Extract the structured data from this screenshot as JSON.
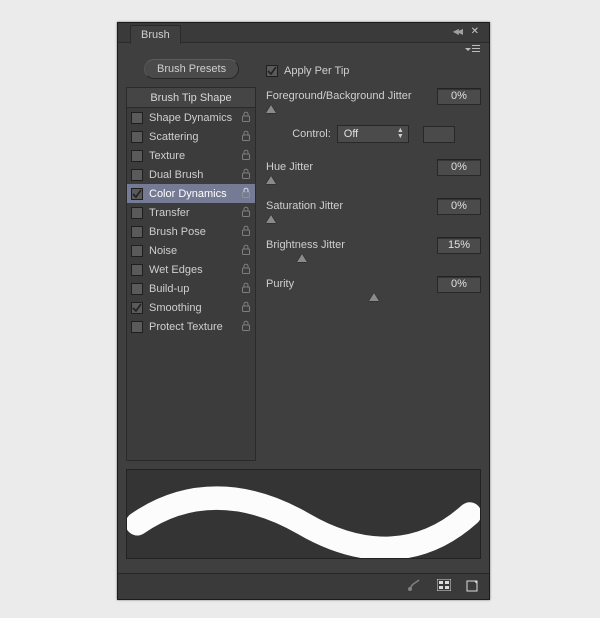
{
  "tab_title": "Brush",
  "brush_presets_label": "Brush Presets",
  "brush_tip_shape_label": "Brush Tip Shape",
  "categories": [
    {
      "label": "Shape Dynamics",
      "checked": false,
      "locked": true
    },
    {
      "label": "Scattering",
      "checked": false,
      "locked": true
    },
    {
      "label": "Texture",
      "checked": false,
      "locked": true
    },
    {
      "label": "Dual Brush",
      "checked": false,
      "locked": true
    },
    {
      "label": "Color Dynamics",
      "checked": true,
      "locked": true,
      "selected": true
    },
    {
      "label": "Transfer",
      "checked": false,
      "locked": true
    },
    {
      "label": "Brush Pose",
      "checked": false,
      "locked": true
    },
    {
      "label": "Noise",
      "checked": false,
      "locked": true
    },
    {
      "label": "Wet Edges",
      "checked": false,
      "locked": true
    },
    {
      "label": "Build-up",
      "checked": false,
      "locked": true
    },
    {
      "label": "Smoothing",
      "checked": true,
      "locked": true
    },
    {
      "label": "Protect Texture",
      "checked": false,
      "locked": true
    }
  ],
  "apply_per_tip": {
    "label": "Apply Per Tip",
    "checked": true
  },
  "fg_bg_jitter": {
    "label": "Foreground/Background Jitter",
    "value": "0%",
    "slider": 0
  },
  "control": {
    "label": "Control:",
    "value": "Off"
  },
  "hue_jitter": {
    "label": "Hue Jitter",
    "value": "0%",
    "slider": 0
  },
  "saturation_jitter": {
    "label": "Saturation Jitter",
    "value": "0%",
    "slider": 0
  },
  "brightness_jitter": {
    "label": "Brightness Jitter",
    "value": "15%",
    "slider": 15
  },
  "purity": {
    "label": "Purity",
    "value": "0%",
    "slider": 50
  }
}
